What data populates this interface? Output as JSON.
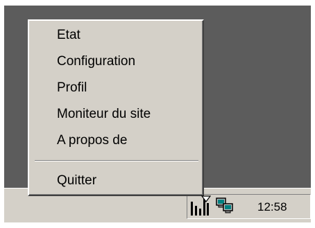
{
  "context_menu": {
    "items": [
      {
        "label": "Etat"
      },
      {
        "label": "Configuration"
      },
      {
        "label": "Profil"
      },
      {
        "label": "Moniteur du site"
      },
      {
        "label": "A propos de"
      },
      {
        "label": "Quitter"
      }
    ]
  },
  "system_tray": {
    "clock": "12:58",
    "icons": [
      "signal-bars-icon",
      "network-computers-icon"
    ]
  },
  "colors": {
    "desktop": "#5c5c5c",
    "menu_face": "#d4d0c8",
    "taskbar": "#d4d0c8"
  }
}
